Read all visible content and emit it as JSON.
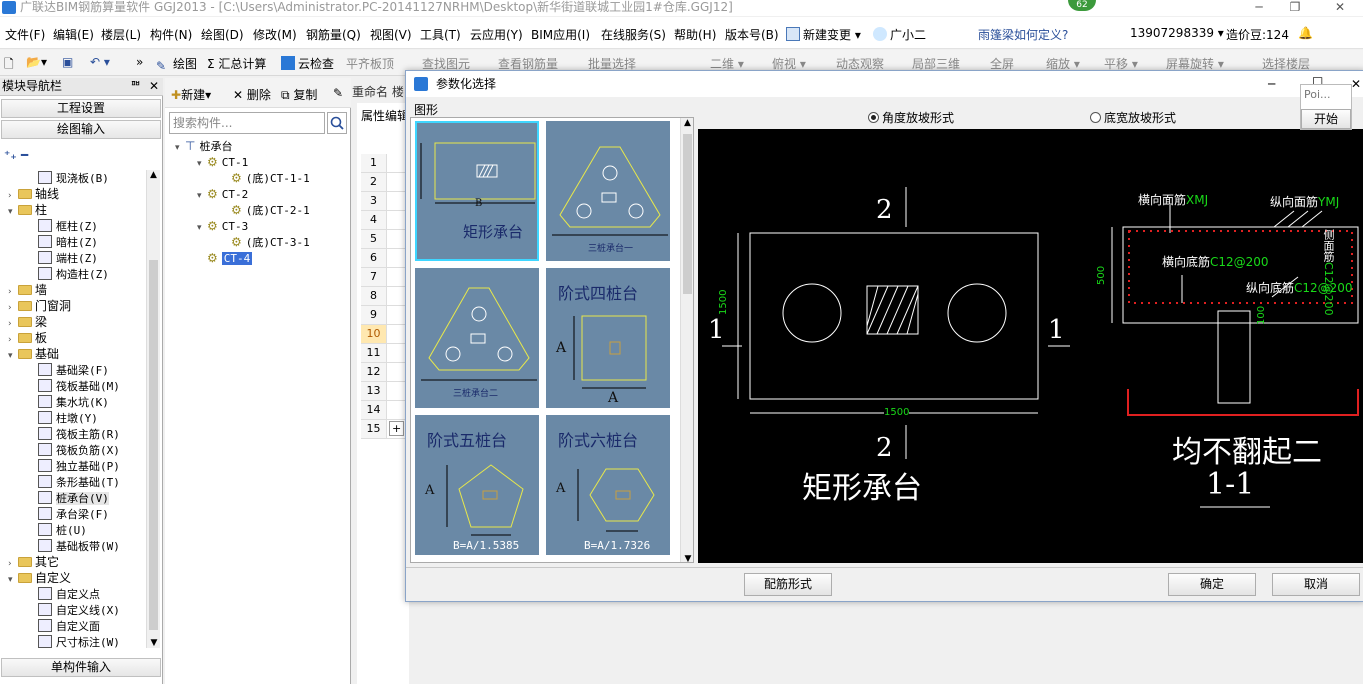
{
  "window": {
    "title": "广联达BIM钢筋算量软件 GGJ2013 - [C:\\Users\\Administrator.PC-20141127NRHM\\Desktop\\新华街道联城工业园1#仓库.GGJ12]",
    "badge": "62",
    "min": "─",
    "restore": "❐",
    "close": "✕"
  },
  "menu": {
    "items": [
      "文件(F)",
      "编辑(E)",
      "楼层(L)",
      "构件(N)",
      "绘图(D)",
      "修改(M)",
      "钢筋量(Q)",
      "视图(V)",
      "工具(T)",
      "云应用(Y)",
      "BIM应用(I)",
      "在线服务(S)",
      "帮助(H)",
      "版本号(B)"
    ],
    "new_change": "新建变更",
    "helper": "广小二",
    "question": "雨篷梁如何定义?",
    "phone": "13907298339",
    "beans": "造价豆:124"
  },
  "toolbar": {
    "draw": "绘图",
    "sum": "汇总计算",
    "cloud_check": "云检查",
    "flat": "平齐板顶",
    "find": "查找图元",
    "view_rebar": "查看钢筋量",
    "batch": "批量选择",
    "view2d": "二维",
    "topview": "俯视",
    "dynamic": "动态观察",
    "local3d": "局部三维",
    "fullscreen": "全屏",
    "zoom": "缩放",
    "pan": "平移",
    "rotate": "屏幕旋转",
    "select_floor": "选择楼层"
  },
  "nav": {
    "title": "模块导航栏",
    "pin": "ᅖ",
    "close": "✕",
    "project_settings": "工程设置",
    "drawing_input": "绘图输入",
    "single_input": "单构件输入",
    "tree": [
      {
        "label": "现浇板(B)",
        "level": 2,
        "kind": "item"
      },
      {
        "label": "轴线",
        "level": 0,
        "kind": "folder",
        "open": false
      },
      {
        "label": "柱",
        "level": 0,
        "kind": "folder",
        "open": true
      },
      {
        "label": "框柱(Z)",
        "level": 2,
        "kind": "item"
      },
      {
        "label": "暗柱(Z)",
        "level": 2,
        "kind": "item"
      },
      {
        "label": "端柱(Z)",
        "level": 2,
        "kind": "item"
      },
      {
        "label": "构造柱(Z)",
        "level": 2,
        "kind": "item"
      },
      {
        "label": "墙",
        "level": 0,
        "kind": "folder",
        "open": false
      },
      {
        "label": "门窗洞",
        "level": 0,
        "kind": "folder",
        "open": false
      },
      {
        "label": "梁",
        "level": 0,
        "kind": "folder",
        "open": false
      },
      {
        "label": "板",
        "level": 0,
        "kind": "folder",
        "open": false
      },
      {
        "label": "基础",
        "level": 0,
        "kind": "folder",
        "open": true
      },
      {
        "label": "基础梁(F)",
        "level": 2,
        "kind": "item"
      },
      {
        "label": "筏板基础(M)",
        "level": 2,
        "kind": "item"
      },
      {
        "label": "集水坑(K)",
        "level": 2,
        "kind": "item"
      },
      {
        "label": "柱墩(Y)",
        "level": 2,
        "kind": "item"
      },
      {
        "label": "筏板主筋(R)",
        "level": 2,
        "kind": "item"
      },
      {
        "label": "筏板负筋(X)",
        "level": 2,
        "kind": "item"
      },
      {
        "label": "独立基础(P)",
        "level": 2,
        "kind": "item"
      },
      {
        "label": "条形基础(T)",
        "level": 2,
        "kind": "item"
      },
      {
        "label": "桩承台(V)",
        "level": 2,
        "kind": "item",
        "selected": true
      },
      {
        "label": "承台梁(F)",
        "level": 2,
        "kind": "item"
      },
      {
        "label": "桩(U)",
        "level": 2,
        "kind": "item"
      },
      {
        "label": "基础板带(W)",
        "level": 2,
        "kind": "item"
      },
      {
        "label": "其它",
        "level": 0,
        "kind": "folder",
        "open": false
      },
      {
        "label": "自定义",
        "level": 0,
        "kind": "folder",
        "open": true
      },
      {
        "label": "自定义点",
        "level": 2,
        "kind": "item"
      },
      {
        "label": "自定义线(X)",
        "level": 2,
        "kind": "item"
      },
      {
        "label": "自定义面",
        "level": 2,
        "kind": "item"
      },
      {
        "label": "尺寸标注(W)",
        "level": 2,
        "kind": "item"
      }
    ]
  },
  "components": {
    "new": "新建",
    "delete": "删除",
    "copy": "复制",
    "rename": "重命名",
    "more": "楼",
    "search_placeholder": "搜索构件...",
    "tree": [
      {
        "label": "桩承台",
        "level": 0
      },
      {
        "label": "CT-1",
        "level": 1
      },
      {
        "label": "(底)CT-1-1",
        "level": 2
      },
      {
        "label": "CT-2",
        "level": 1
      },
      {
        "label": "(底)CT-2-1",
        "level": 2
      },
      {
        "label": "CT-3",
        "level": 1
      },
      {
        "label": "(底)CT-3-1",
        "level": 2
      },
      {
        "label": "CT-4",
        "level": 1,
        "selected": true
      }
    ]
  },
  "props": {
    "title": "属性编辑",
    "rows": [
      "1",
      "2",
      "3",
      "4",
      "5",
      "6",
      "7",
      "8",
      "9",
      "10",
      "11",
      "12",
      "13",
      "14",
      "15"
    ],
    "selected_row": "10",
    "expand": "+"
  },
  "dialog": {
    "title": "参数化选择",
    "group": "图形",
    "min": "─",
    "max": "□",
    "close": "✕",
    "radio_angle": "角度放坡形式",
    "radio_width": "底宽放坡形式",
    "thumbs": {
      "rect": {
        "caption": "矩形承台",
        "dim": "B"
      },
      "three1": {
        "caption": "三桩承台一"
      },
      "three2": {
        "caption": "三桩承台二"
      },
      "step4": {
        "caption": "阶式四桩台",
        "dimA": "A"
      },
      "step5": {
        "caption": "阶式五桩台",
        "dimA": "A",
        "formula": "B=A/1.5385"
      },
      "step6": {
        "caption": "阶式六桩台",
        "dimA": "A",
        "formula": "B=A/1.7326"
      }
    },
    "preview": {
      "sec2_top": "2",
      "sec2_bottom": "2",
      "sec1_left": "1",
      "sec1_right": "1",
      "dim_height": "1500",
      "dim_width": "1500",
      "name": "矩形承台",
      "lbl_h_top": "横向面筋",
      "val_h_top": "XMJ",
      "lbl_v_top": "纵向面筋",
      "val_v_top": "YMJ",
      "lbl_h_bot": "横向底筋",
      "val_h_bot": "C12@200",
      "lbl_v_bot": "纵向底筋",
      "val_v_bot": "C12@200",
      "lbl_side": "侧面筋",
      "val_side": "C12@200",
      "dim_thick": "500",
      "dim_cover": "100",
      "section_title": "均不翻起二",
      "section_no": "1-1"
    },
    "btn_rebar": "配筋形式",
    "btn_ok": "确定",
    "btn_cancel": "取消"
  },
  "popup": {
    "label": "Poi...",
    "start": "开始"
  }
}
